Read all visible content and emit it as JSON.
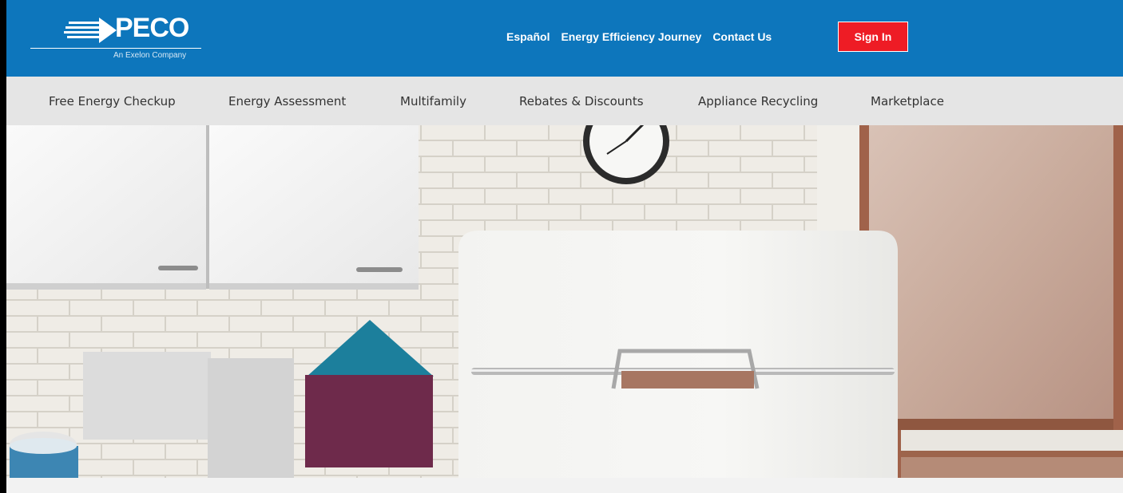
{
  "header": {
    "logo_text": "PECO",
    "logo_tagline": "An Exelon Company",
    "brand_color": "#0d76bc",
    "utility_links": [
      "Español",
      "Energy Efficiency Journey",
      "Contact Us"
    ],
    "signin_label": "Sign In",
    "signin_color": "#ee1c25"
  },
  "nav": {
    "items": [
      "Free Energy Checkup",
      "Energy Assessment",
      "Multifamily",
      "Rebates & Discounts",
      "Appliance Recycling",
      "Marketplace"
    ]
  },
  "hero": {
    "image_icon": "kitchen-refrigerator-photo"
  }
}
